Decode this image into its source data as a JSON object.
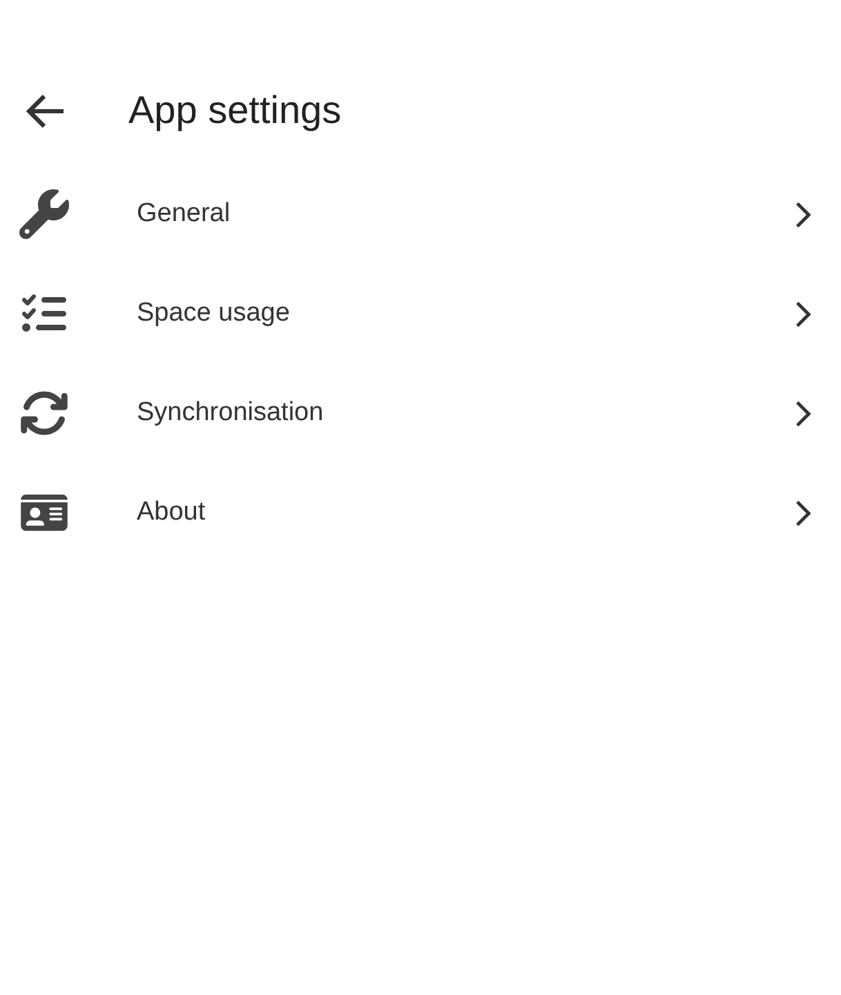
{
  "header": {
    "title": "App settings"
  },
  "items": [
    {
      "label": "General"
    },
    {
      "label": "Space usage"
    },
    {
      "label": "Synchronisation"
    },
    {
      "label": "About"
    }
  ]
}
